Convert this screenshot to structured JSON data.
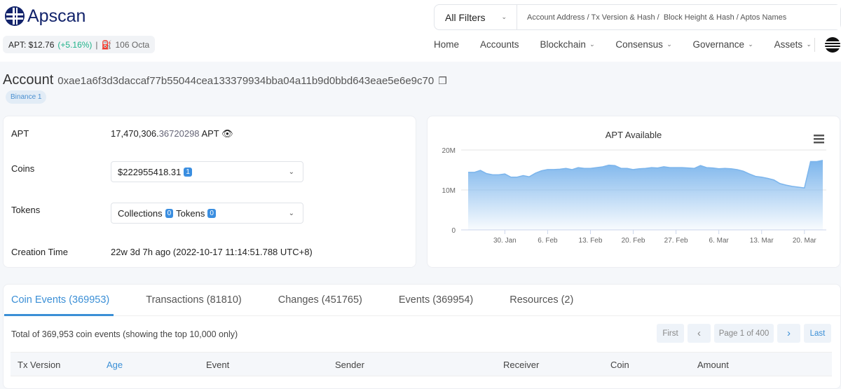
{
  "header": {
    "logo": "Apscan",
    "price_label": "APT: $12.76",
    "price_change": "(+5.16%)",
    "gas": "106 Octa",
    "filter": "All Filters",
    "search_placeholder": "Account Address / Tx Version & Hash /  Block Height & Hash / Aptos Names",
    "nav": [
      "Home",
      "Accounts",
      "Blockchain",
      "Consensus",
      "Governance",
      "Assets"
    ]
  },
  "account": {
    "title": "Account",
    "address": "0xae1a6f3d3daccaf77b55044cea133379934bba04a11b9d0bbd643eae5e6e9c70",
    "tag": "Binance 1"
  },
  "overview": {
    "apt_label": "APT",
    "apt_int": "17,470,306.",
    "apt_dec": "36720298",
    "apt_unit": "APT",
    "coins_label": "Coins",
    "coins_value": "$222955418.31",
    "coins_count": "1",
    "tokens_label": "Tokens",
    "collections_label": "Collections",
    "collections_count": "0",
    "tokens_sub": "Tokens",
    "tokens_count": "0",
    "creation_label": "Creation Time",
    "creation_value": "22w 3d 7h ago (2022-10-17 11:14:51.788 UTC+8)"
  },
  "chart_data": {
    "type": "area",
    "title": "APT Available",
    "ylabel": "",
    "xlabel": "",
    "ylim": [
      0,
      20000000
    ],
    "yticks": [
      "0",
      "10M",
      "20M"
    ],
    "xticks": [
      {
        "label": "30. Jan",
        "day": 6
      },
      {
        "label": "6. Feb",
        "day": 13
      },
      {
        "label": "13. Feb",
        "day": 20
      },
      {
        "label": "20. Feb",
        "day": 27
      },
      {
        "label": "27. Feb",
        "day": 34
      },
      {
        "label": "6. Mar",
        "day": 41
      },
      {
        "label": "13. Mar",
        "day": 48
      },
      {
        "label": "20. Mar",
        "day": 55
      }
    ],
    "x_start": "2023-01-24",
    "x_step": "1 day",
    "values_millions": [
      14.4,
      14.4,
      14.9,
      14.1,
      13.8,
      13.8,
      14.0,
      13.2,
      13.2,
      13.6,
      13.3,
      14.2,
      14.8,
      15.1,
      15.1,
      15.2,
      15.4,
      15.1,
      15.6,
      15.4,
      15.4,
      15.6,
      15.8,
      16.2,
      16.1,
      15.4,
      15.4,
      15.1,
      15.3,
      15.4,
      15.6,
      15.5,
      15.8,
      15.6,
      15.6,
      15.6,
      15.5,
      15.4,
      16.1,
      15.6,
      15.5,
      15.3,
      15.4,
      15.3,
      15.1,
      14.7,
      14.0,
      13.4,
      13.2,
      12.9,
      12.5,
      11.6,
      11.2,
      10.9,
      10.7,
      10.5,
      17.1,
      17.1,
      17.4
    ],
    "color": "#7cb5ec"
  },
  "tabs": [
    "Coin Events (369953)",
    "Transactions (81810)",
    "Changes (451765)",
    "Events (369954)",
    "Resources (2)"
  ],
  "table": {
    "summary": "Total of 369,953 coin events (showing the top 10,000 only)",
    "pagination": {
      "first": "First",
      "prev": "‹",
      "page": "Page 1 of 400",
      "next": "›",
      "last": "Last"
    },
    "columns": [
      "Tx Version",
      "Age",
      "Event",
      "Sender",
      "Receiver",
      "Coin",
      "Amount"
    ]
  }
}
